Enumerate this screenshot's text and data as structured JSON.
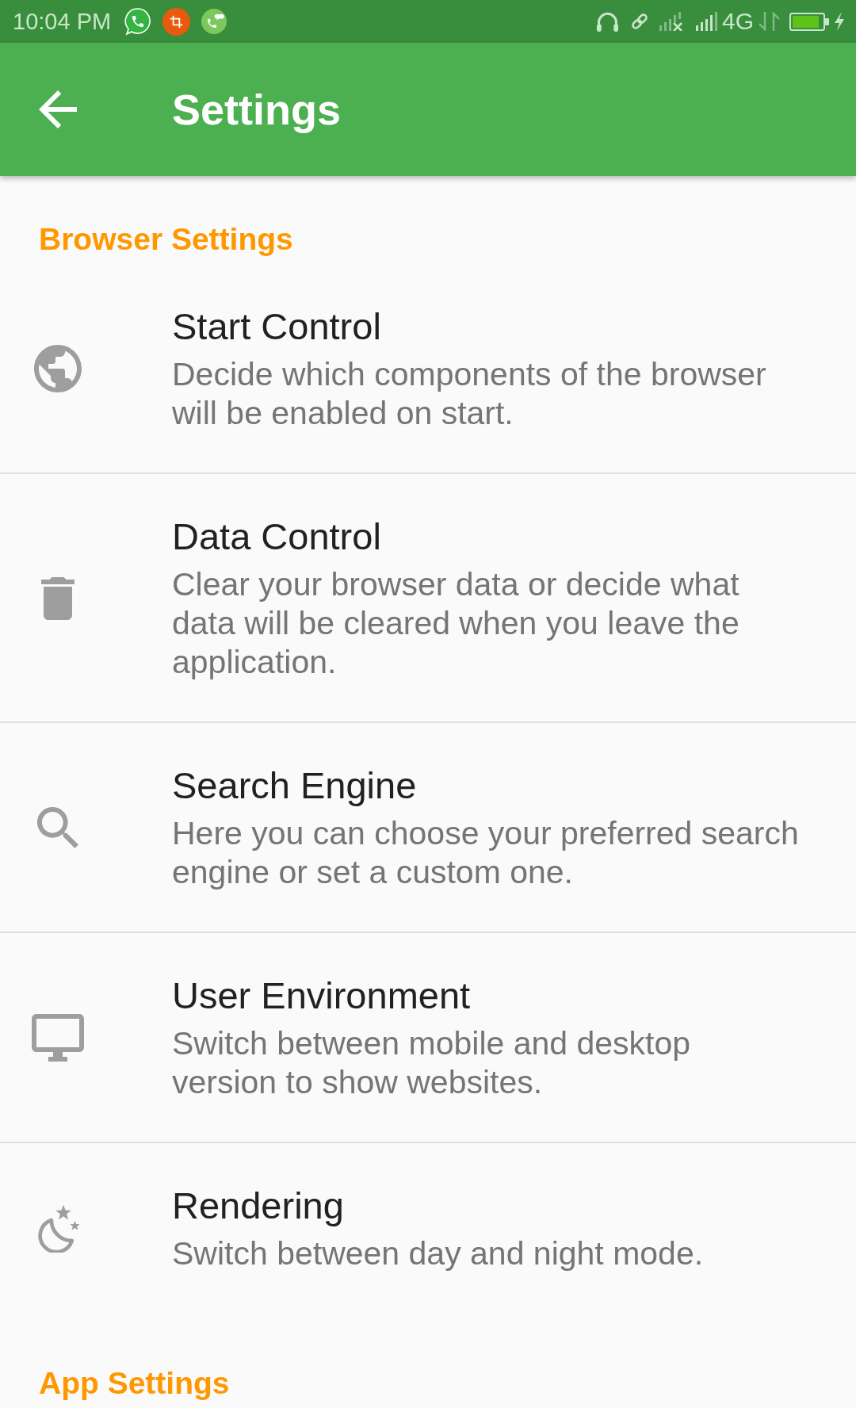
{
  "status_bar": {
    "time": "10:04 PM",
    "network_type": "4G"
  },
  "app_bar": {
    "title": "Settings"
  },
  "sections": [
    {
      "header": "Browser Settings",
      "items": [
        {
          "title": "Start Control",
          "description": "Decide which components of the browser will be enabled on start."
        },
        {
          "title": "Data Control",
          "description": "Clear your browser data or decide what data will be cleared when you leave the application."
        },
        {
          "title": "Search Engine",
          "description": "Here you can choose your preferred search engine or set a custom one."
        },
        {
          "title": "User Environment",
          "description": "Switch between mobile and desktop version to show websites."
        },
        {
          "title": "Rendering",
          "description": "Switch between day and night mode."
        }
      ]
    },
    {
      "header": "App Settings"
    }
  ]
}
